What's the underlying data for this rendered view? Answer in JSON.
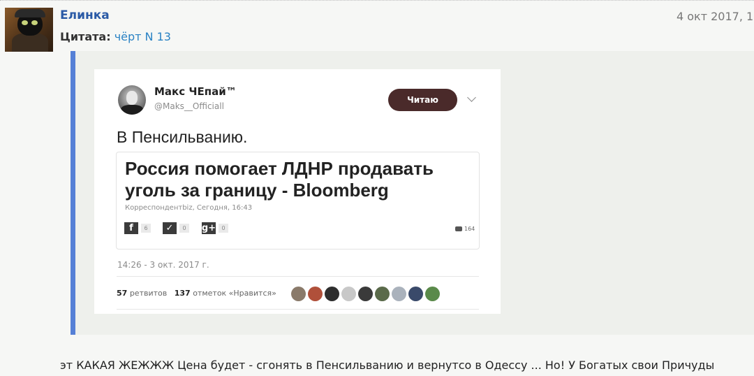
{
  "post": {
    "author": "Елинка",
    "date": "4 окт 2017, 1",
    "quote_label": "Цитата:",
    "quote_source": "чёрт N 13",
    "message": "эт КАКАЯ ЖЕЖЖЖ Цена будет - сгонять в Пенсильванию и вернутсо в Одессу ... Но! У Богатых свои Причуды"
  },
  "tweet": {
    "name": "Макс ЧЕпай™",
    "handle": "@Maks__Officiall",
    "follow_label": "Читаю",
    "text": "В Пенсильванию.",
    "card": {
      "title": "Россия помогает ЛДНР продавать уголь за границу - Bloomberg",
      "meta": "Корреспондентbiz, Сегодня, 16:43",
      "fb_icon": "f",
      "fb_count": "6",
      "tw_icon": "✓",
      "tw_count": "0",
      "gp_icon": "g+",
      "gp_count": "0",
      "comments": "164"
    },
    "time": "14:26 - 3 окт. 2017 г.",
    "retweets_count": "57",
    "retweets_label": "ретвитов",
    "likes_count": "137",
    "likes_label": "отметок «Нравится»"
  },
  "colors": {
    "author": "#2a5aa6",
    "quote_source": "#2a82c4",
    "quote_border": "#5580d6",
    "follow_button": "#4a2a2a",
    "likers": [
      "#8a7a6a",
      "#b0503a",
      "#2e2e2e",
      "#c8c8c8",
      "#3a3a3a",
      "#5a6a4a",
      "#aab2bc",
      "#3a4a6a",
      "#5a8a4a"
    ]
  }
}
